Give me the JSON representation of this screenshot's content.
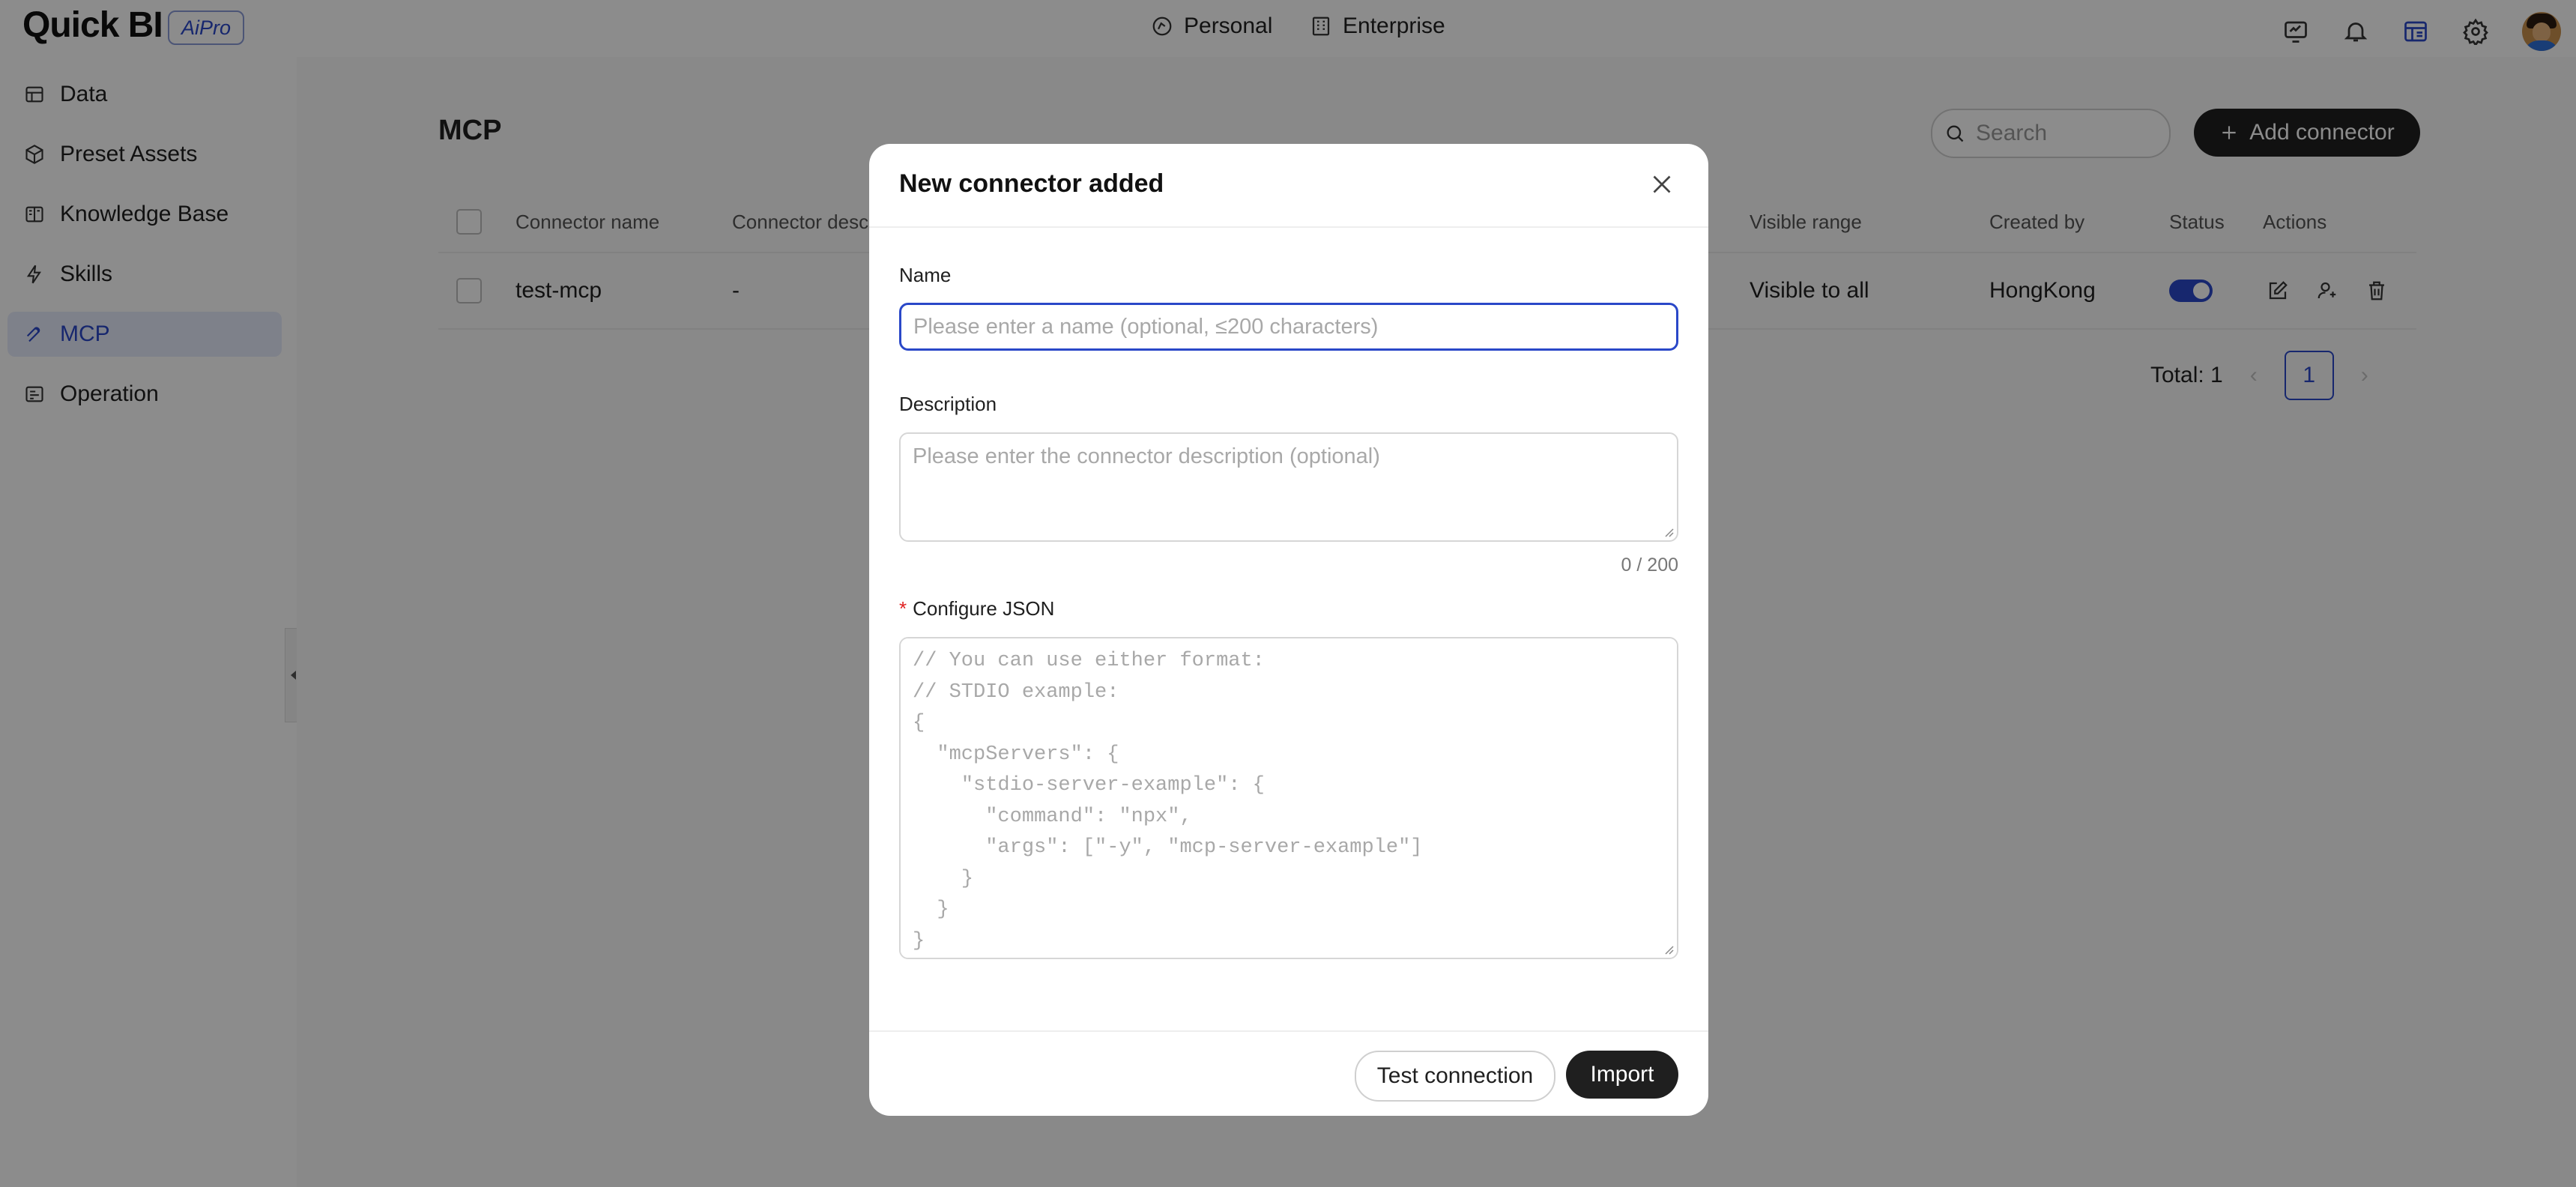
{
  "app": {
    "logo": "Quick BI",
    "badge": "AiPro",
    "nav": [
      {
        "label": "Personal",
        "icon": "personal-icon"
      },
      {
        "label": "Enterprise",
        "icon": "enterprise-icon"
      }
    ],
    "top_icons": [
      "monitor-icon",
      "bell-icon",
      "dashboard-icon",
      "gear-icon"
    ]
  },
  "sidebar": {
    "items": [
      {
        "label": "Data",
        "icon": "table-icon"
      },
      {
        "label": "Preset Assets",
        "icon": "cube-icon"
      },
      {
        "label": "Knowledge Base",
        "icon": "book-icon"
      },
      {
        "label": "Skills",
        "icon": "lightning-icon"
      },
      {
        "label": "MCP",
        "icon": "mcp-icon",
        "active": true
      },
      {
        "label": "Operation",
        "icon": "operation-icon"
      }
    ]
  },
  "main": {
    "title": "MCP",
    "search_placeholder": "Search",
    "add_button": "Add connector",
    "columns": [
      "Connector name",
      "Connector desc",
      "Visible range",
      "Created by",
      "Status",
      "Actions"
    ],
    "rows": [
      {
        "name": "test-mcp",
        "description": "-",
        "visible_range": "Visible to all",
        "created_by": "HongKong",
        "status": "enabled"
      }
    ],
    "total_label": "Total: 1",
    "page": "1"
  },
  "modal": {
    "title": "New connector added",
    "name_label": "Name",
    "name_placeholder": "Please enter a name (optional, ≤200 characters)",
    "description_label": "Description",
    "description_placeholder": "Please enter the connector description (optional)",
    "counter": "0 / 200",
    "json_label": "Configure JSON",
    "json_placeholder": "// You can use either format:\n// STDIO example:\n{\n  \"mcpServers\": {\n    \"stdio-server-example\": {\n      \"command\": \"npx\",\n      \"args\": [\"-y\", \"mcp-server-example\"]\n    }\n  }\n}",
    "test_button": "Test connection",
    "import_button": "Import"
  }
}
